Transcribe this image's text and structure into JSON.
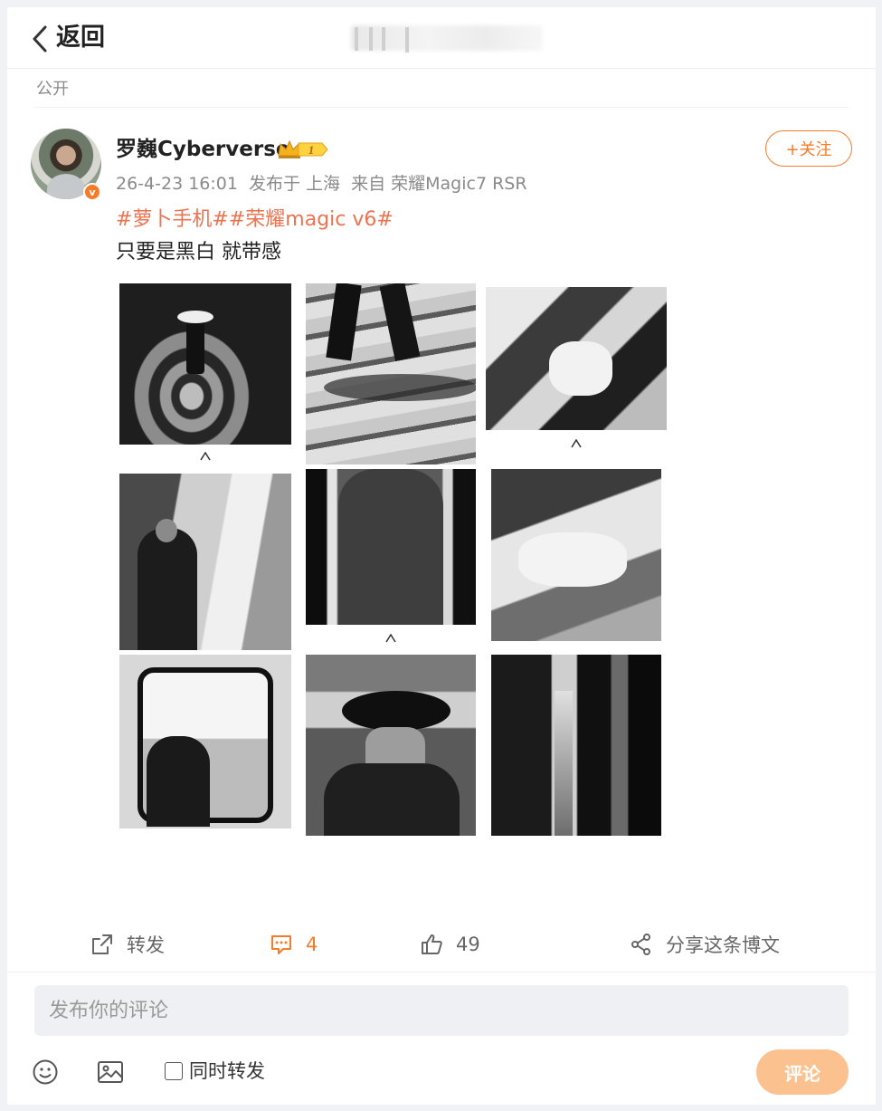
{
  "header": {
    "back_label": "返回",
    "visibility": "公开"
  },
  "author": {
    "name": "罗巍Cyberverse",
    "level_badge": "1",
    "verified_icon": "v",
    "follow_label": "+关注"
  },
  "post": {
    "date": "26-4-23 16:01",
    "location": "发布于 上海",
    "device": "来自 荣耀Magic7 RSR",
    "topics": "#萝卜手机##荣耀magic v6#",
    "text": "只要是黑白 就带感",
    "images": [
      {
        "name": "photo-fisherman"
      },
      {
        "name": "photo-walking-legs"
      },
      {
        "name": "photo-train-sleepers"
      },
      {
        "name": "photo-platform-woman"
      },
      {
        "name": "photo-man-back"
      },
      {
        "name": "photo-sleeping-passenger"
      },
      {
        "name": "photo-window-woman"
      },
      {
        "name": "photo-hat-man"
      },
      {
        "name": "photo-train-corridor"
      }
    ]
  },
  "actions": {
    "repost_label": "转发",
    "comment_count": "4",
    "like_count": "49",
    "share_label": "分享这条博文"
  },
  "composer": {
    "placeholder": "发布你的评论",
    "repost_label": "同时转发",
    "submit_label": "评论"
  },
  "colors": {
    "accent": "#f77b27",
    "topic": "#eb7350",
    "submit_disabled": "#fbc290"
  }
}
